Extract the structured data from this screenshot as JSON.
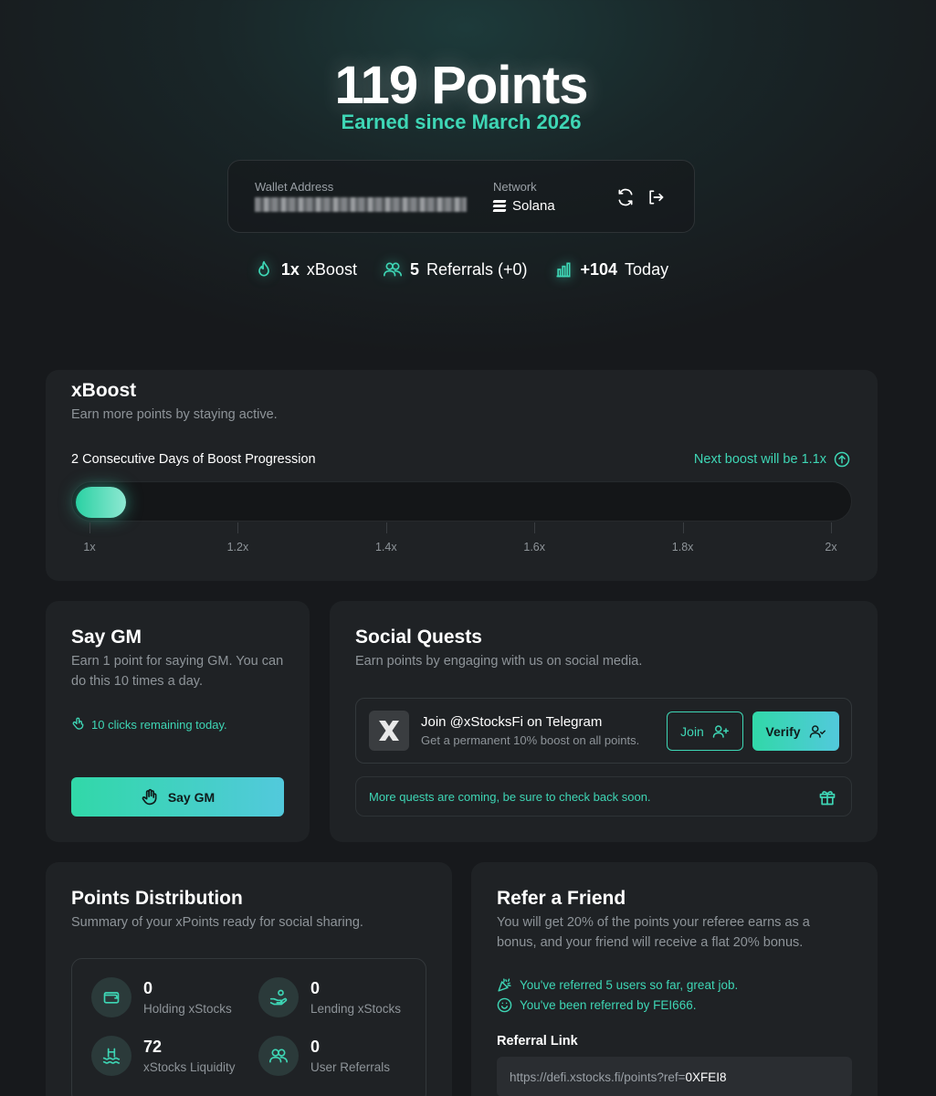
{
  "hero": {
    "points_title": "119 Points",
    "earned_since": "Earned since March 2026"
  },
  "wallet": {
    "address_label": "Wallet Address",
    "network_label": "Network",
    "network_value": "Solana"
  },
  "stats": {
    "boost_value": "1x",
    "boost_label": "xBoost",
    "referrals_value": "5",
    "referrals_label": "Referrals (+0)",
    "today_value": "+104",
    "today_label": "Today"
  },
  "xboost": {
    "title": "xBoost",
    "subtitle": "Earn more points by staying active.",
    "progress_label": "2 Consecutive Days of Boost Progression",
    "next_boost": "Next boost will be 1.1x",
    "progress_fraction": 0.065,
    "ticks": [
      "1x",
      "1.2x",
      "1.4x",
      "1.6x",
      "1.8x",
      "2x"
    ]
  },
  "say_gm": {
    "title": "Say GM",
    "subtitle": "Earn 1 point for saying GM. You can do this 10 times a day.",
    "remaining": "10 clicks remaining today.",
    "button_label": "Say GM"
  },
  "social_quests": {
    "title": "Social Quests",
    "subtitle": "Earn points by engaging with us on social media.",
    "quest_title": "Join @xStocksFi on Telegram",
    "quest_desc": "Get a permanent 10% boost on all points.",
    "join_label": "Join",
    "verify_label": "Verify",
    "more_text": "More quests are coming, be sure to check back soon."
  },
  "distribution": {
    "title": "Points Distribution",
    "subtitle": "Summary of your xPoints ready for social sharing.",
    "items": [
      {
        "value": "0",
        "label": "Holding xStocks",
        "icon": "wallet-icon"
      },
      {
        "value": "0",
        "label": "Lending xStocks",
        "icon": "hand-coin-icon"
      },
      {
        "value": "72",
        "label": "xStocks Liquidity",
        "icon": "waves-icon"
      },
      {
        "value": "0",
        "label": "User Referrals",
        "icon": "users-icon"
      }
    ]
  },
  "refer": {
    "title": "Refer a Friend",
    "subtitle": "You will get 20% of the points your referee earns as a bonus, and your friend will receive a flat 20% bonus.",
    "referred_count_text": "You've referred 5 users so far, great job.",
    "referred_by_text": "You've been referred by FEI666.",
    "link_label": "Referral Link",
    "link_prefix": "https://defi.xstocks.fi/points?ref=",
    "link_code": "0XFEI8"
  },
  "colors": {
    "accent": "#3ed6b5",
    "background": "#17191c",
    "card": "#1f2225"
  }
}
